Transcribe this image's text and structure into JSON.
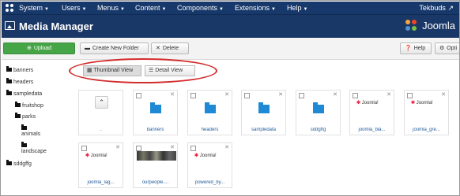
{
  "navbar": {
    "menus": [
      "System",
      "Users",
      "Menus",
      "Content",
      "Components",
      "Extensions",
      "Help"
    ],
    "site": "Tekbuds"
  },
  "header": {
    "title": "Media Manager",
    "brand": "Joomla"
  },
  "toolbar": {
    "upload": "Upload",
    "new_folder": "Create New Folder",
    "delete": "Delete",
    "help": "Help",
    "options": "Opti"
  },
  "tree": [
    "banners",
    "headers",
    "sampledata",
    "fruitshop",
    "parks",
    "animals",
    "landscape",
    "sddgffg"
  ],
  "views": {
    "thumbnail": "Thumbnail View",
    "detail": "Detail View"
  },
  "items": [
    {
      "name": "..",
      "kind": "up"
    },
    {
      "name": "banners",
      "kind": "folder"
    },
    {
      "name": "headers",
      "kind": "folder"
    },
    {
      "name": "sampledata",
      "kind": "folder"
    },
    {
      "name": "sddgffg",
      "kind": "folder"
    },
    {
      "name": "joomla_bla...",
      "kind": "image"
    },
    {
      "name": "joomla_gre...",
      "kind": "image"
    },
    {
      "name": "joomla_lag...",
      "kind": "image"
    },
    {
      "name": "ourpeople....",
      "kind": "photo"
    },
    {
      "name": "powered_by...",
      "kind": "image"
    }
  ],
  "image_logo_text": "Joomla!",
  "colors": {
    "navbar": "#17386a",
    "header": "#1a3867",
    "upload": "#46a546",
    "folder": "#1e8ad6",
    "highlight": "#d42a2a"
  }
}
